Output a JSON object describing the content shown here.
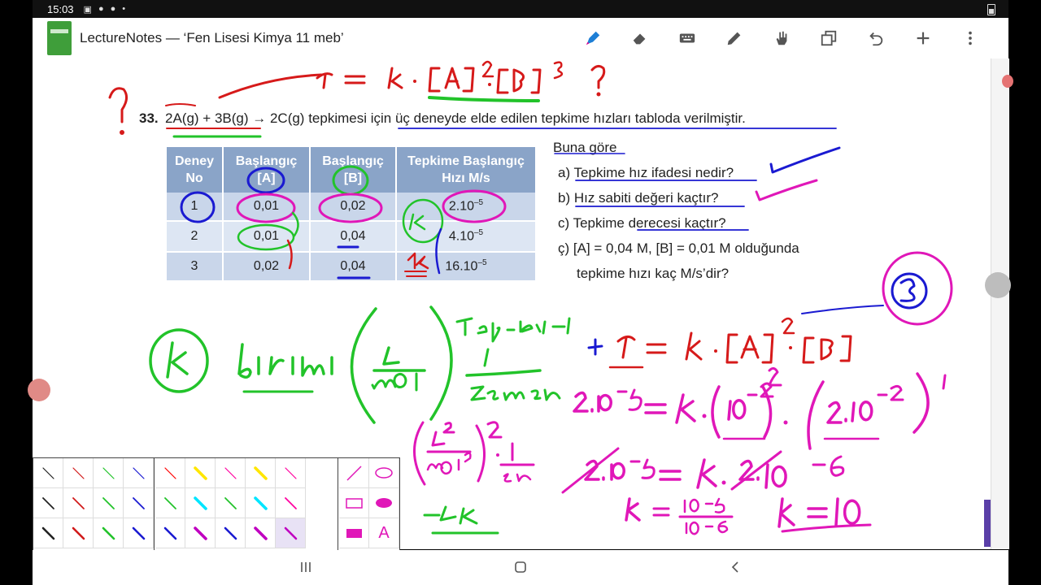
{
  "status_bar": {
    "time": "15:03",
    "icons": [
      "image-icon",
      "alert-icon",
      "alert-icon",
      "dot-icon"
    ]
  },
  "app": {
    "title": "LectureNotes — ‘Fen Lisesi Kimya 11 meb’"
  },
  "toolbar": {
    "tools": [
      "pen-marker-icon",
      "eraser-icon",
      "keyboard-icon",
      "pencil-icon",
      "hand-icon",
      "copy-icon",
      "undo-icon",
      "add-icon",
      "more-vert-icon"
    ]
  },
  "question": {
    "number": "33.",
    "text": "2A(g) + 3B(g)  →  2C(g) tepkimesi için üç deneyde elde edilen tepkime hızları tabloda verilmiştir."
  },
  "table": {
    "headers": [
      [
        "Deney",
        "No"
      ],
      [
        "Başlangıç",
        "[A]"
      ],
      [
        "Başlangıç",
        "[B]"
      ],
      [
        "Tepkime Başlangıç",
        "Hızı M/s"
      ]
    ],
    "rows": [
      {
        "no": "1",
        "a": "0,01",
        "b": "0,02",
        "rate_base": "2.10",
        "rate_exp": "–5"
      },
      {
        "no": "2",
        "a": "0,01",
        "b": "0,04",
        "rate_base": "4.10",
        "rate_exp": "–5"
      },
      {
        "no": "3",
        "a": "0,02",
        "b": "0,04",
        "rate_base": "16.10",
        "rate_exp": "–5"
      }
    ]
  },
  "items": {
    "intro": "Buna göre",
    "a": "a) Tepkime hız ifadesi nedir?",
    "b": "b) Hız sabiti değeri kaçtır?",
    "c": "c) Tepkime derecesi kaçtır?",
    "d1": "ç)  [A]  =  0,04  M,  [B]  =  0,01  M  olduğunda",
    "d2": "tepkime hızı kaç M/s’dir?"
  },
  "palette": {
    "pen_colors": [
      "#222222",
      "#d11a1a",
      "#22c32a",
      "#1a1ad1",
      "#ff0000",
      "#ffe600",
      "#ff00a0",
      "#00e5ff",
      "#c000c0"
    ],
    "tool_labels": {
      "text": "A"
    }
  },
  "nav": {
    "buttons": [
      "recents-button",
      "home-button",
      "back-button"
    ]
  },
  "handwriting": {
    "top_formula": "r = k.[A]².[B]³ ?",
    "k_unit": "k birimi (L/mol) Tep.der-1 1/zaman",
    "k_unit_2": "(L²/mol²)² . 1/sn",
    "k_result": "= 4k",
    "rate_law": "r = k.[A]².[B]",
    "order": "3",
    "calc1": "2.10⁻⁵ = k.(10⁻²)².(2.10⁻²)¹",
    "calc2": "2.10⁻⁵ = k.2.10⁻⁶",
    "calc3": "k = 10⁻⁵ / 10⁻⁶",
    "answer": "k = 10"
  }
}
